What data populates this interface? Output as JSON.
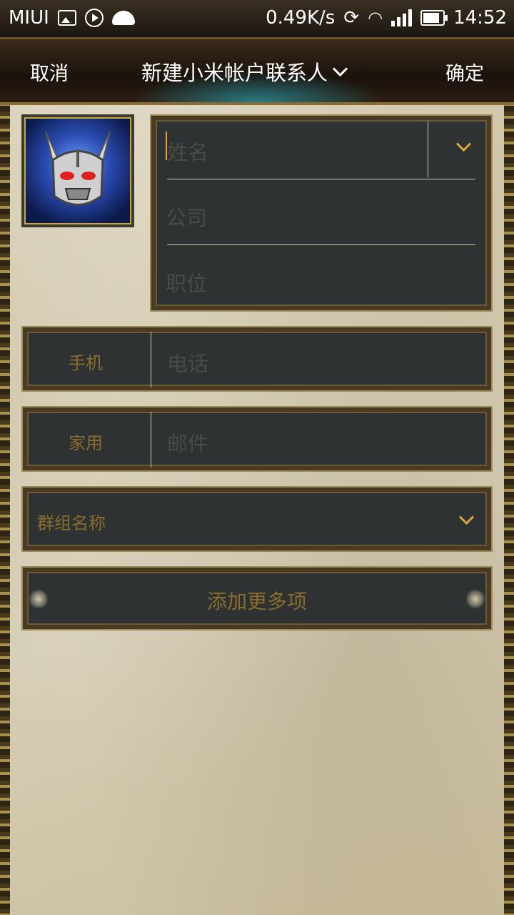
{
  "status_bar": {
    "carrier": "MIUI",
    "speed": "0.49K/s",
    "time": "14:52"
  },
  "title_bar": {
    "cancel_label": "取消",
    "title": "新建小米帐户联系人",
    "ok_label": "确定"
  },
  "name_panel": {
    "name_placeholder": "姓名",
    "company_placeholder": "公司",
    "position_placeholder": "职位"
  },
  "phone_row": {
    "type_label": "手机",
    "placeholder": "电话"
  },
  "email_row": {
    "type_label": "家用",
    "placeholder": "邮件"
  },
  "group_row": {
    "label": "群组名称"
  },
  "add_more": {
    "label": "添加更多项"
  },
  "colors": {
    "panel_bg": "#2f3233",
    "gold_text": "#8a6d2e",
    "placeholder_text": "#4a4b45",
    "chevron": "#d9a63a"
  }
}
